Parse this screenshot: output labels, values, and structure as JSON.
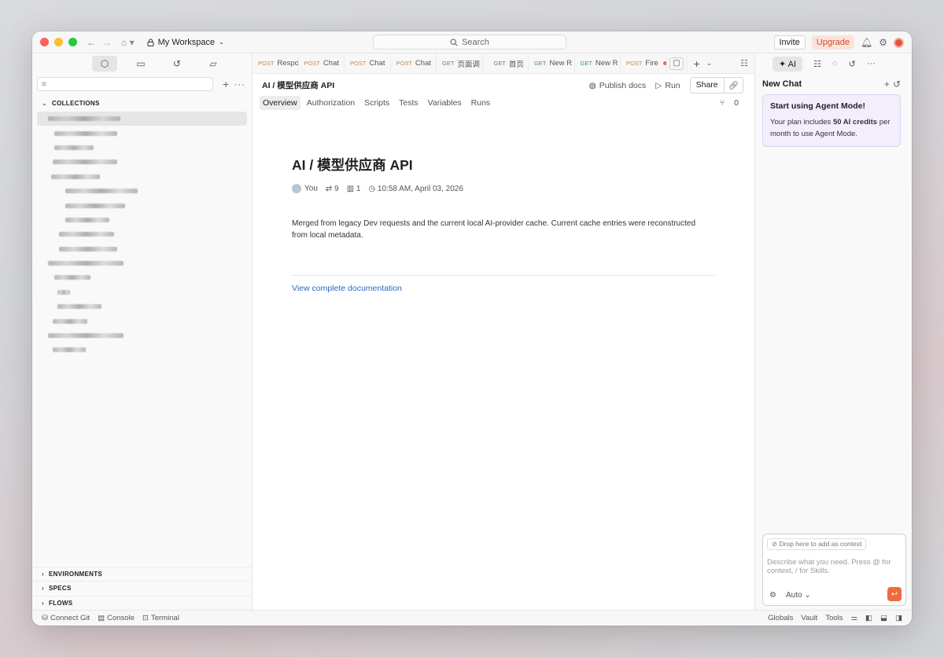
{
  "titlebar": {
    "workspace": "My Workspace",
    "search_placeholder": "Search",
    "invite": "Invite",
    "upgrade": "Upgrade"
  },
  "sidebar": {
    "collections_label": "COLLECTIONS",
    "environments_label": "ENVIRONMENTS",
    "specs_label": "SPECS",
    "flows_label": "FLOWS"
  },
  "tabs": [
    {
      "method": "POST",
      "label": "Respo"
    },
    {
      "method": "POST",
      "label": "Chat"
    },
    {
      "method": "POST",
      "label": "Chat"
    },
    {
      "method": "POST",
      "label": "Chat"
    },
    {
      "method": "GET",
      "label": "页面调"
    },
    {
      "method": "GET",
      "label": "首页"
    },
    {
      "method": "GET",
      "label": "New R"
    },
    {
      "method": "GET",
      "label": "New R"
    },
    {
      "method": "POST",
      "label": "Fire"
    }
  ],
  "main": {
    "breadcrumb": "AI / 模型供应商 API",
    "publish_docs": "Publish docs",
    "run": "Run",
    "share": "Share",
    "subtabs": [
      "Overview",
      "Authorization",
      "Scripts",
      "Tests",
      "Variables",
      "Runs"
    ],
    "fork_count": "0",
    "title": "AI / 模型供应商 API",
    "owner": "You",
    "requests_count": "9",
    "monitors_count": "1",
    "timestamp": "10:58 AM, April 03, 2026",
    "description": "Merged from legacy Dev requests and the current local AI-provider cache. Current cache entries were reconstructed from local metadata.",
    "doc_link": "View complete documentation"
  },
  "right_panel": {
    "ai_label": "AI",
    "new_chat": "New Chat",
    "card_title": "Start using Agent Mode!",
    "card_text_1": "Your plan includes ",
    "card_credits": "50 AI credits",
    "card_text_2": " per month to use Agent Mode.",
    "drop_hint": "Drop here to add as context",
    "chat_placeholder": "Describe what you need. Press @ for context, / for Skills.",
    "mode": "Auto"
  },
  "statusbar": {
    "connect_git": "Connect Git",
    "console": "Console",
    "terminal": "Terminal",
    "globals": "Globals",
    "vault": "Vault",
    "tools": "Tools"
  },
  "colors": {
    "accent": "#ef6b3e",
    "post_method": "#c98c35",
    "get_method": "#3a9a61",
    "link": "#2f67c2"
  }
}
